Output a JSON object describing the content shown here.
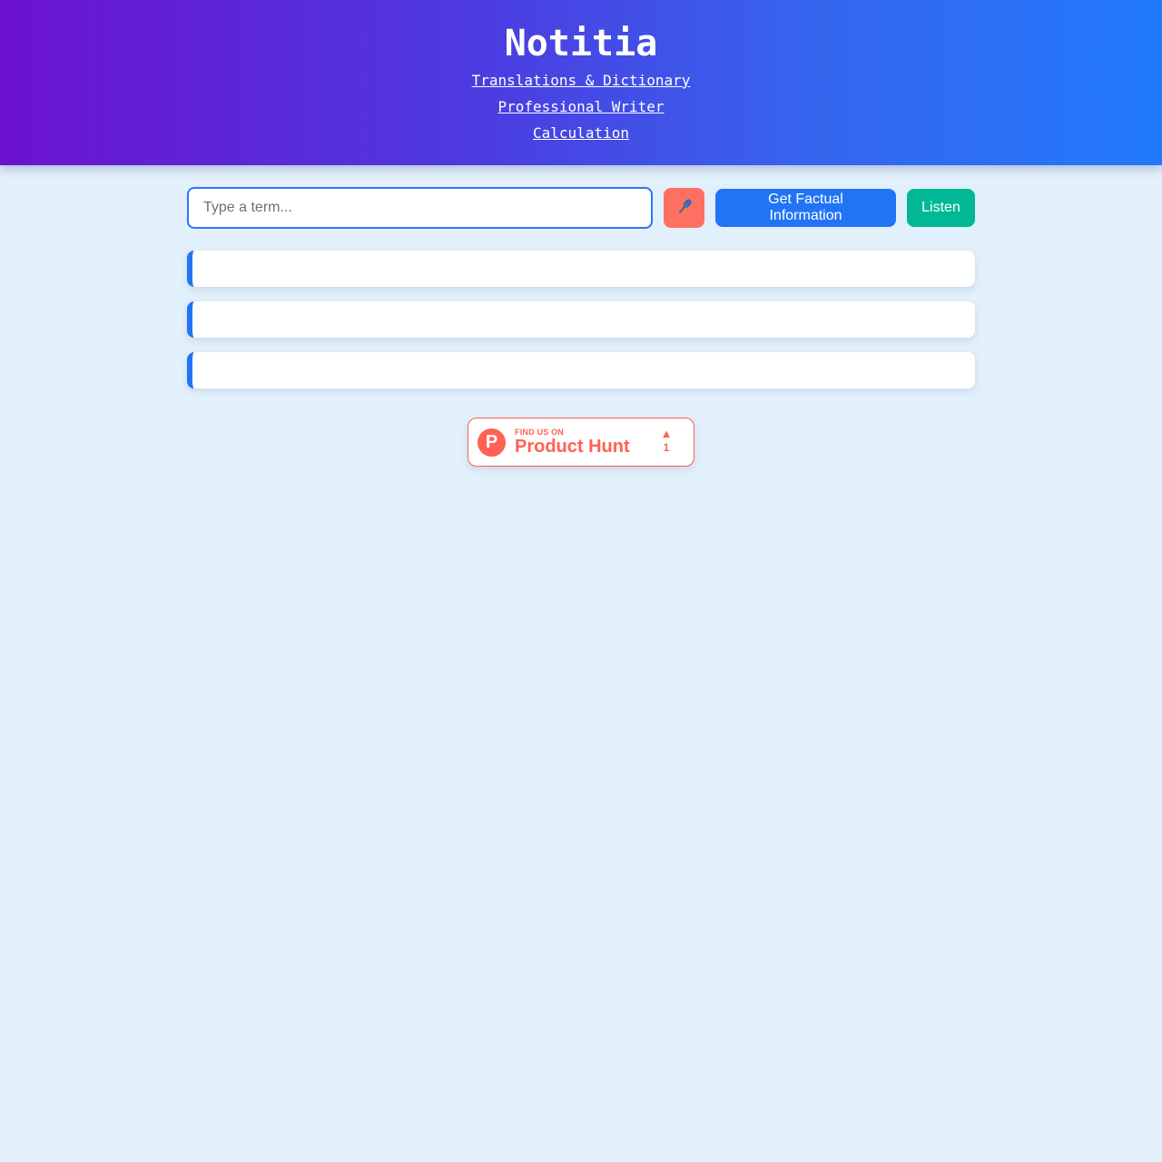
{
  "header": {
    "title": "Notitia",
    "links": [
      "Translations & Dictionary",
      "Professional Writer",
      "Calculation"
    ]
  },
  "search": {
    "placeholder": "Type a term...",
    "value": "",
    "mic_icon": "microphone-icon",
    "fact_button": "Get Factual Information",
    "listen_button": "Listen"
  },
  "results": [
    {
      "text": ""
    },
    {
      "text": ""
    },
    {
      "text": ""
    }
  ],
  "product_hunt": {
    "logo_letter": "P",
    "small_text": "FIND US ON",
    "big_text": "Product Hunt",
    "upvote_icon": "triangle-up-icon",
    "upvotes": "1"
  },
  "colors": {
    "gradient_start": "#6c12ce",
    "gradient_end": "#2179fc",
    "primary": "#2175f5",
    "mic": "#fe7062",
    "listen": "#00b894",
    "product_hunt": "#ff6154",
    "background": "#e2f0fb"
  }
}
